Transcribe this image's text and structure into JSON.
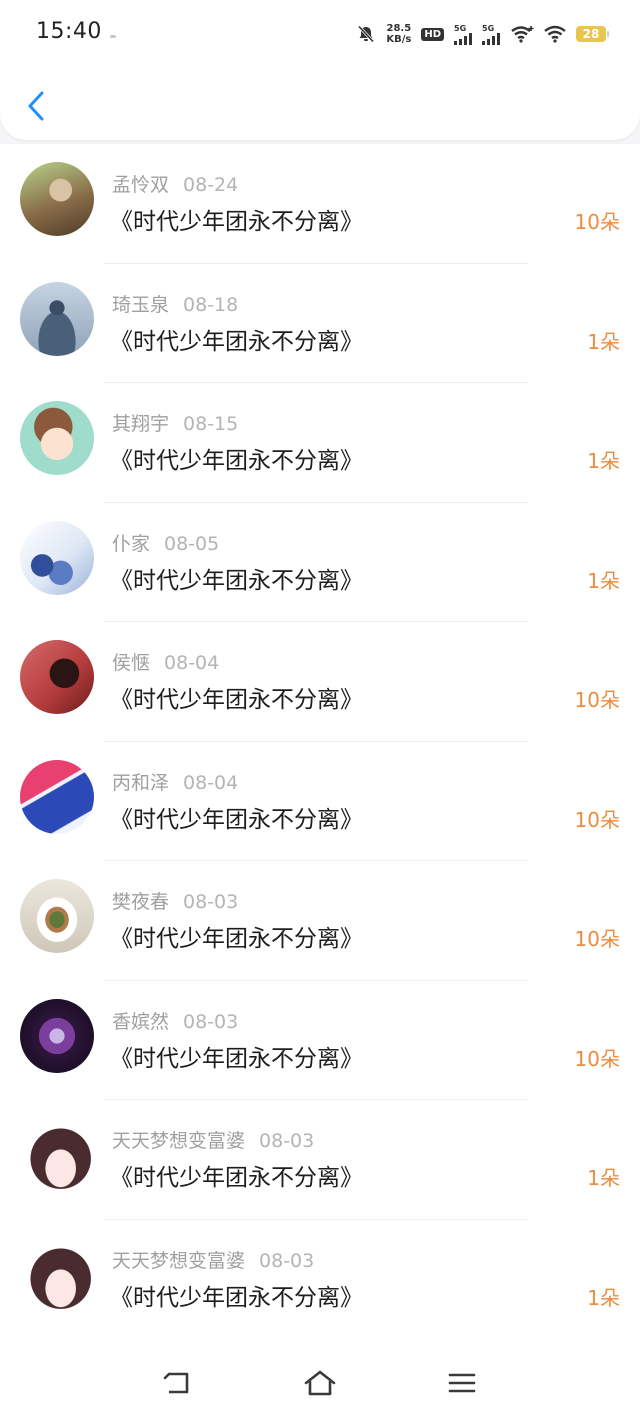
{
  "status_bar": {
    "time": "15:40",
    "net_speed_value": "28.5",
    "net_speed_unit": "KB/s",
    "hd_label": "HD",
    "sim1_label": "5G",
    "sim2_label": "5G",
    "battery": "28"
  },
  "accent_color": "#1e90ff",
  "count_color": "#f08a3c",
  "items": [
    {
      "name": "孟怜双",
      "date": "08-24",
      "title": "《时代少年团永不分离》",
      "count": "10朵"
    },
    {
      "name": "琦玉泉",
      "date": "08-18",
      "title": "《时代少年团永不分离》",
      "count": "1朵"
    },
    {
      "name": "其翔宇",
      "date": "08-15",
      "title": "《时代少年团永不分离》",
      "count": "1朵"
    },
    {
      "name": "仆家",
      "date": "08-05",
      "title": "《时代少年团永不分离》",
      "count": "1朵"
    },
    {
      "name": "侯惬",
      "date": "08-04",
      "title": "《时代少年团永不分离》",
      "count": "10朵"
    },
    {
      "name": "丙和泽",
      "date": "08-04",
      "title": "《时代少年团永不分离》",
      "count": "10朵"
    },
    {
      "name": "樊夜春",
      "date": "08-03",
      "title": "《时代少年团永不分离》",
      "count": "10朵"
    },
    {
      "name": "香嫔然",
      "date": "08-03",
      "title": "《时代少年团永不分离》",
      "count": "10朵"
    },
    {
      "name": "天天梦想变富婆",
      "date": "08-03",
      "title": "《时代少年团永不分离》",
      "count": "1朵"
    },
    {
      "name": "天天梦想变富婆",
      "date": "08-03",
      "title": "《时代少年团永不分离》",
      "count": "1朵"
    }
  ]
}
